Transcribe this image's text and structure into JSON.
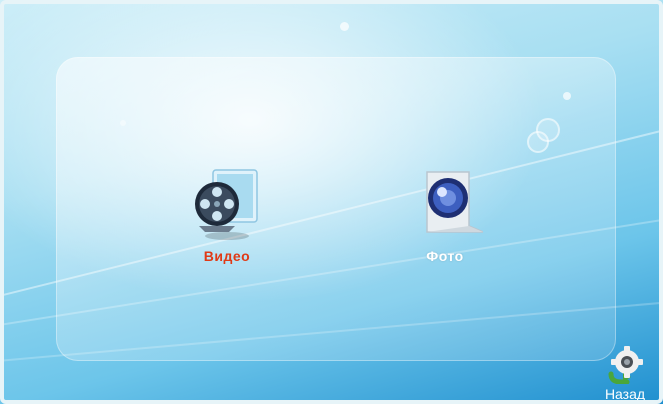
{
  "menu": {
    "items": [
      {
        "label": "Видео",
        "icon": "video-icon",
        "state": "selected",
        "color": "#e03a16"
      },
      {
        "label": "Фото",
        "icon": "photo-icon",
        "state": "normal",
        "color": "#ffffff"
      }
    ]
  },
  "back": {
    "label": "Назад",
    "icon": "gear-back-icon"
  },
  "theme": {
    "accent": "#e03a16",
    "background": "#6cc5ea"
  }
}
